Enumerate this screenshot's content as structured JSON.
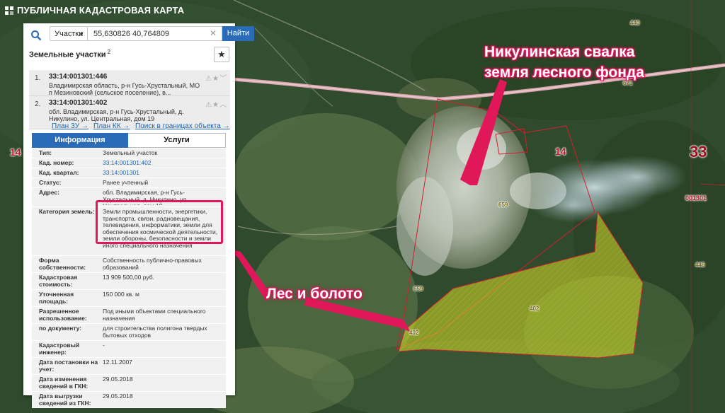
{
  "header": {
    "title": "ПУБЛИЧНАЯ КАДАСТРОВАЯ КАРТА"
  },
  "search": {
    "type_selected": "Участки",
    "query": "55,630826 40,764809",
    "find_label": "Найти"
  },
  "section": {
    "title": "Земельные участки",
    "count": "2"
  },
  "results": [
    {
      "num": "1.",
      "cad": "33:14:001301:446",
      "address": "Владимирская область, р-н Гусь-Хрустальный, МО п Мезиновский (сельское поселение), в..."
    },
    {
      "num": "2.",
      "cad": "33:14:001301:402",
      "address": "обл. Владимирская, р-н Гусь-Хрустальный, д. Никулино, ул. Центральная, дом 19"
    }
  ],
  "links": {
    "plan_zu": "План ЗУ →",
    "plan_kk": "План КК →",
    "search_bounds": "Поиск в границах объекта →"
  },
  "tabs": {
    "info": "Информация",
    "services": "Услуги"
  },
  "properties": [
    {
      "label": "Тип:",
      "value": "Земельный участок"
    },
    {
      "label": "Кад. номер:",
      "value": "33:14:001301:402"
    },
    {
      "label": "Кад. квартал:",
      "value": "33:14:001301"
    },
    {
      "label": "Статус:",
      "value": "Ранее учтенный"
    },
    {
      "label": "Адрес:",
      "value": "обл. Владимирская, р-н Гусь-Хрустальный, д. Никулино, ул. Центральная, дом 19"
    },
    {
      "label": "Категория земель:",
      "value": "Земли промышленности, энергетики, транспорта, связи, радиовещания, телевидения, информатики, земли для обеспечения космической деятельности, земли обороны, безопасности и земли иного специального назначения"
    },
    {
      "label": "Форма собственности:",
      "value": "Собственность публично-правовых образований"
    },
    {
      "label": "Кадастровая стоимость:",
      "value": "13 909 500,00 руб."
    },
    {
      "label": "Уточненная площадь:",
      "value": "150 000 кв. м"
    },
    {
      "label": "Разрешенное использование:",
      "value": "Под иными объектами специального назначения"
    },
    {
      "label": "по документу:",
      "value": "для строительства полигона твердых бытовых отходов"
    },
    {
      "label": "Кадастровый инженер:",
      "value": "-"
    },
    {
      "label": "Дата постановки на учет:",
      "value": "12.11.2007"
    },
    {
      "label": "Дата изменения сведений в ГКН:",
      "value": "29.05.2018"
    },
    {
      "label": "Дата выгрузки сведений из ГКН:",
      "value": "29.05.2018"
    }
  ],
  "annotations": {
    "dump_line1": "Никулинская свалка",
    "dump_line2": "земля лесного фонда",
    "forest": "Лес и болото"
  },
  "map_labels": {
    "quarter_14_left": "14",
    "quarter_14_right": "14",
    "district_33": "33",
    "block_001301": "001301",
    "road_671": "671",
    "plot_440": "440",
    "plot_446": "446",
    "plot_659_a": "659",
    "plot_659_b": "659",
    "plot_402_center": "402",
    "plot_402_edge": "402"
  },
  "colors": {
    "accent": "#2b6cb8",
    "highlight": "#e0185a",
    "parcel_fill": "#d6dc2a",
    "boundary": "#d0202e"
  }
}
